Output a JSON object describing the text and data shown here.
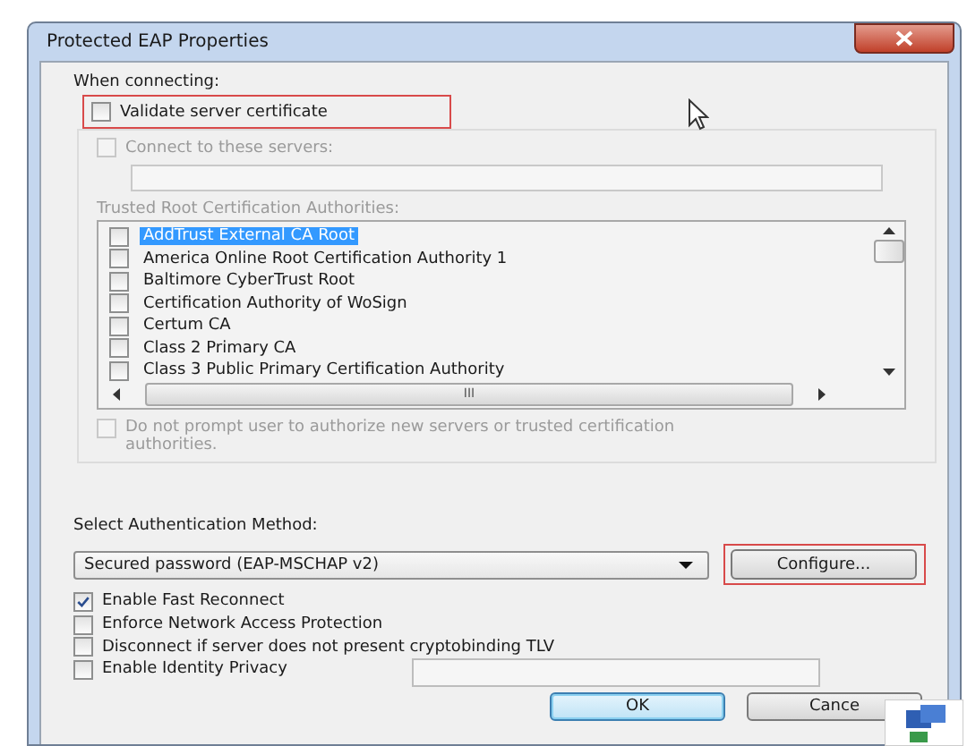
{
  "window": {
    "title": "Protected EAP Properties"
  },
  "when_connecting": {
    "label": "When connecting:",
    "validate": {
      "label": "Validate server certificate",
      "checked": false,
      "highlighted": true
    },
    "connect_servers": {
      "label": "Connect to these servers:",
      "checked": false,
      "disabled": true
    },
    "trusted_label": "Trusted Root Certification Authorities:",
    "authorities": [
      {
        "name": "AddTrust External CA Root",
        "checked": false,
        "selected": true
      },
      {
        "name": "America Online Root Certification Authority 1",
        "checked": false,
        "selected": false
      },
      {
        "name": "Baltimore CyberTrust Root",
        "checked": false,
        "selected": false
      },
      {
        "name": "Certification Authority of WoSign",
        "checked": false,
        "selected": false
      },
      {
        "name": "Certum CA",
        "checked": false,
        "selected": false
      },
      {
        "name": "Class 2 Primary CA",
        "checked": false,
        "selected": false
      },
      {
        "name": "Class 3 Public Primary Certification Authority",
        "checked": false,
        "selected": false
      }
    ],
    "hscroll_thumb": "III",
    "no_prompt": {
      "label": "Do not prompt user to authorize new servers or trusted certification authorities.",
      "checked": false,
      "disabled": true
    }
  },
  "auth": {
    "label": "Select Authentication Method:",
    "method": "Secured password (EAP-MSCHAP v2)",
    "configure": {
      "label": "Configure...",
      "highlighted": true
    }
  },
  "options": [
    {
      "label": "Enable Fast Reconnect",
      "checked": true,
      "kind": "checkbox"
    },
    {
      "label": "Enforce Network Access Protection",
      "checked": false,
      "kind": "checkbox"
    },
    {
      "label": "Disconnect if server does not present cryptobinding TLV",
      "checked": false,
      "kind": "checkbox"
    },
    {
      "label": "Enable Identity Privacy",
      "checked": false,
      "kind": "checkbox-field"
    }
  ],
  "buttons": [
    {
      "label": "OK",
      "kind": "default"
    },
    {
      "label": "Cance",
      "kind": "normal"
    }
  ]
}
